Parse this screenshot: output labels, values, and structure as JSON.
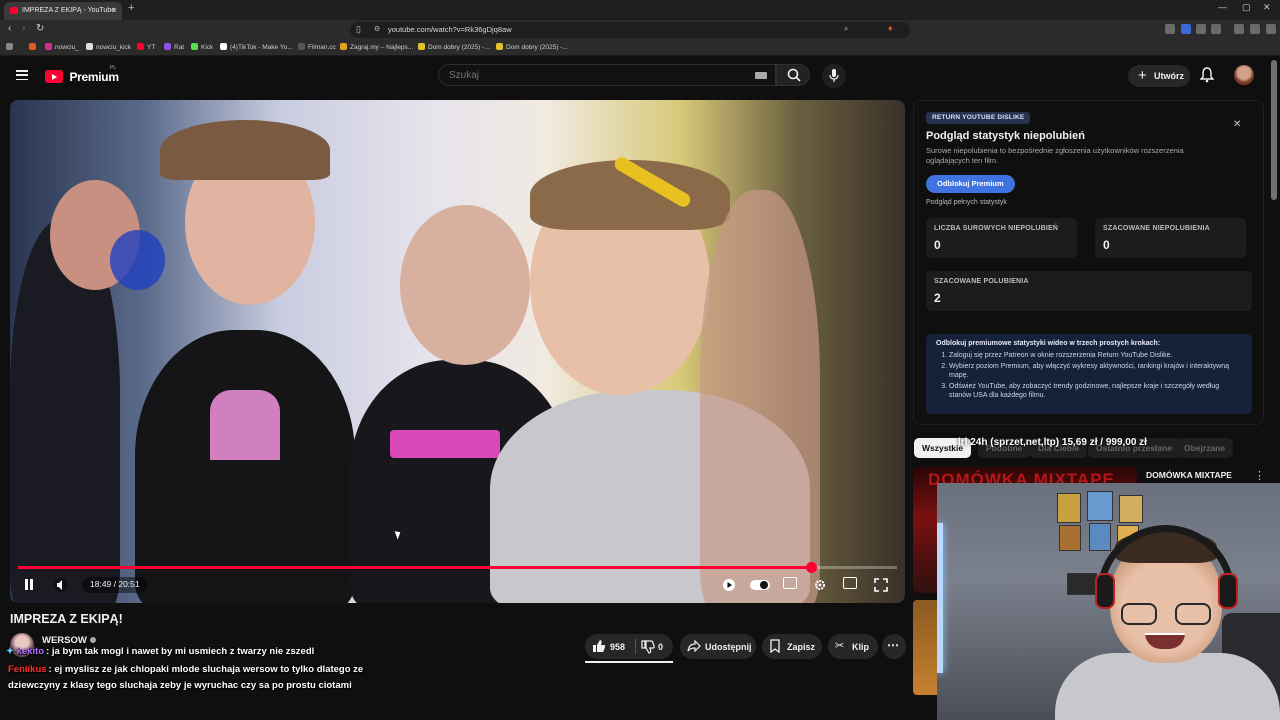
{
  "browser": {
    "tab_title": "IMPREZA Z EKIPĄ - YouTube",
    "url": "youtube.com/watch?v=Rk36gDjq8aw",
    "bookmarks": [
      "nowciu_",
      "nowciu_kick",
      "YT",
      "Rat",
      "Kick",
      "(4)TikTok - Make Yo...",
      "Filman.cc",
      "Zagraj.my – Najleps...",
      "Dom dobry (2025) -...",
      "Dom dobry (2025) -..."
    ]
  },
  "header": {
    "logo_text": "Premium",
    "country_code": "PL",
    "search_placeholder": "Szukaj",
    "create_label": "Utwórz"
  },
  "player": {
    "time": "18:49 / 20:51",
    "progress_fraction": 0.9026
  },
  "video": {
    "title": "IMPREZA Z EKIPĄ!",
    "channel": "WERSOW",
    "likes": "958",
    "dislikes": "0",
    "share_label": "Udostępnij",
    "save_label": "Zapisz",
    "clip_label": "Klip"
  },
  "chat": [
    {
      "user": "kekito",
      "user_color": "#b070ff",
      "text": ": ja bym tak mogl i nawet by mi usmiech z twarzy nie zszedl"
    },
    {
      "user": "Feniikus",
      "user_color": "#ff3030",
      "text": ": ej myslisz ze jak chlopaki mlode sluchaja wersow to tylko dlatego ze"
    },
    {
      "user": "",
      "user_color": "#ffffff",
      "text": "dziewczyny z klasy tego sluchaja zeby je wyruchac czy sa po prostu ciotami"
    }
  ],
  "ryd": {
    "badge": "RETURN YOUTUBE DISLIKE",
    "title": "Podgląd statystyk niepolubień",
    "description": "Surowe niepolubienia to bezpośrednie zgłoszenia użytkowników rozszerzenia oglądających ten film.",
    "button": "Odblokuj Premium",
    "sub": "Podgląd pełnych statystyk",
    "stats": [
      {
        "label": "LICZBA SUROWYCH NIEPOLUBIEŃ",
        "value": "0"
      },
      {
        "label": "SZACOWANE NIEPOLUBIENIA",
        "value": "0"
      },
      {
        "label": "SZACOWANE POLUBIENIA",
        "value": "2"
      }
    ],
    "steps_head": "Odblokuj premiumowe statystyki wideo w trzech prostych krokach:",
    "steps": [
      "Zaloguj się przez Patreon w oknie rozszerzenia Return YouTube Dislike.",
      "Wybierz poziom Premium, aby włączyć wykresy aktywności, rankingi krajów i interaktywną mapę.",
      "Odśwież YouTube, aby zobaczyć trendy godzinowe, najlepsze kraje i szczegóły według stanów USA dla każdego filmu."
    ]
  },
  "chips": [
    "Wszystkie",
    "Podobne",
    "Dla Ciebie",
    "Ostatnio przesłane",
    "Obejrzane"
  ],
  "donation": "lrl 24h (sprzet,net,ltp)       15,69 zł  /  999,00 zł",
  "recommended": {
    "thumb_text": "DOMÓWKA MIXTAPE",
    "title": "DOMÓWKA MIXTAPE"
  }
}
